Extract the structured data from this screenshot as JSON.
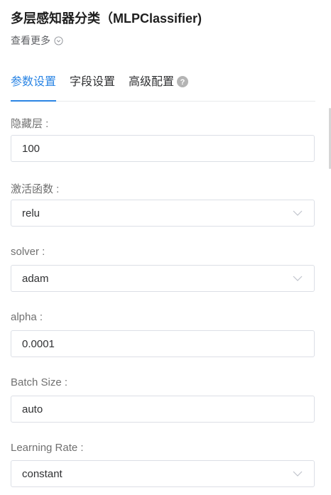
{
  "header": {
    "title": "多层感知器分类（MLPClassifier)",
    "see_more": "查看更多"
  },
  "tabs": [
    {
      "label": "参数设置",
      "active": true
    },
    {
      "label": "字段设置",
      "active": false
    },
    {
      "label": "高级配置",
      "active": false
    }
  ],
  "fields": {
    "hidden_layers": {
      "label": "隐藏层 :",
      "value": "100"
    },
    "activation": {
      "label": "激活函数 :",
      "value": "relu"
    },
    "solver": {
      "label": "solver :",
      "value": "adam"
    },
    "alpha": {
      "label": "alpha :",
      "value": "0.0001"
    },
    "batch_size": {
      "label": "Batch Size :",
      "value": "auto"
    },
    "learning_rate": {
      "label": "Learning Rate :",
      "value": "constant"
    }
  },
  "colors": {
    "accent": "#2b85e4",
    "border": "#dcdfe6",
    "label": "#707070"
  },
  "icons": {
    "see_more": "chevron-down-circle-icon",
    "help": "question-circle-icon",
    "select": "chevron-down-icon"
  }
}
